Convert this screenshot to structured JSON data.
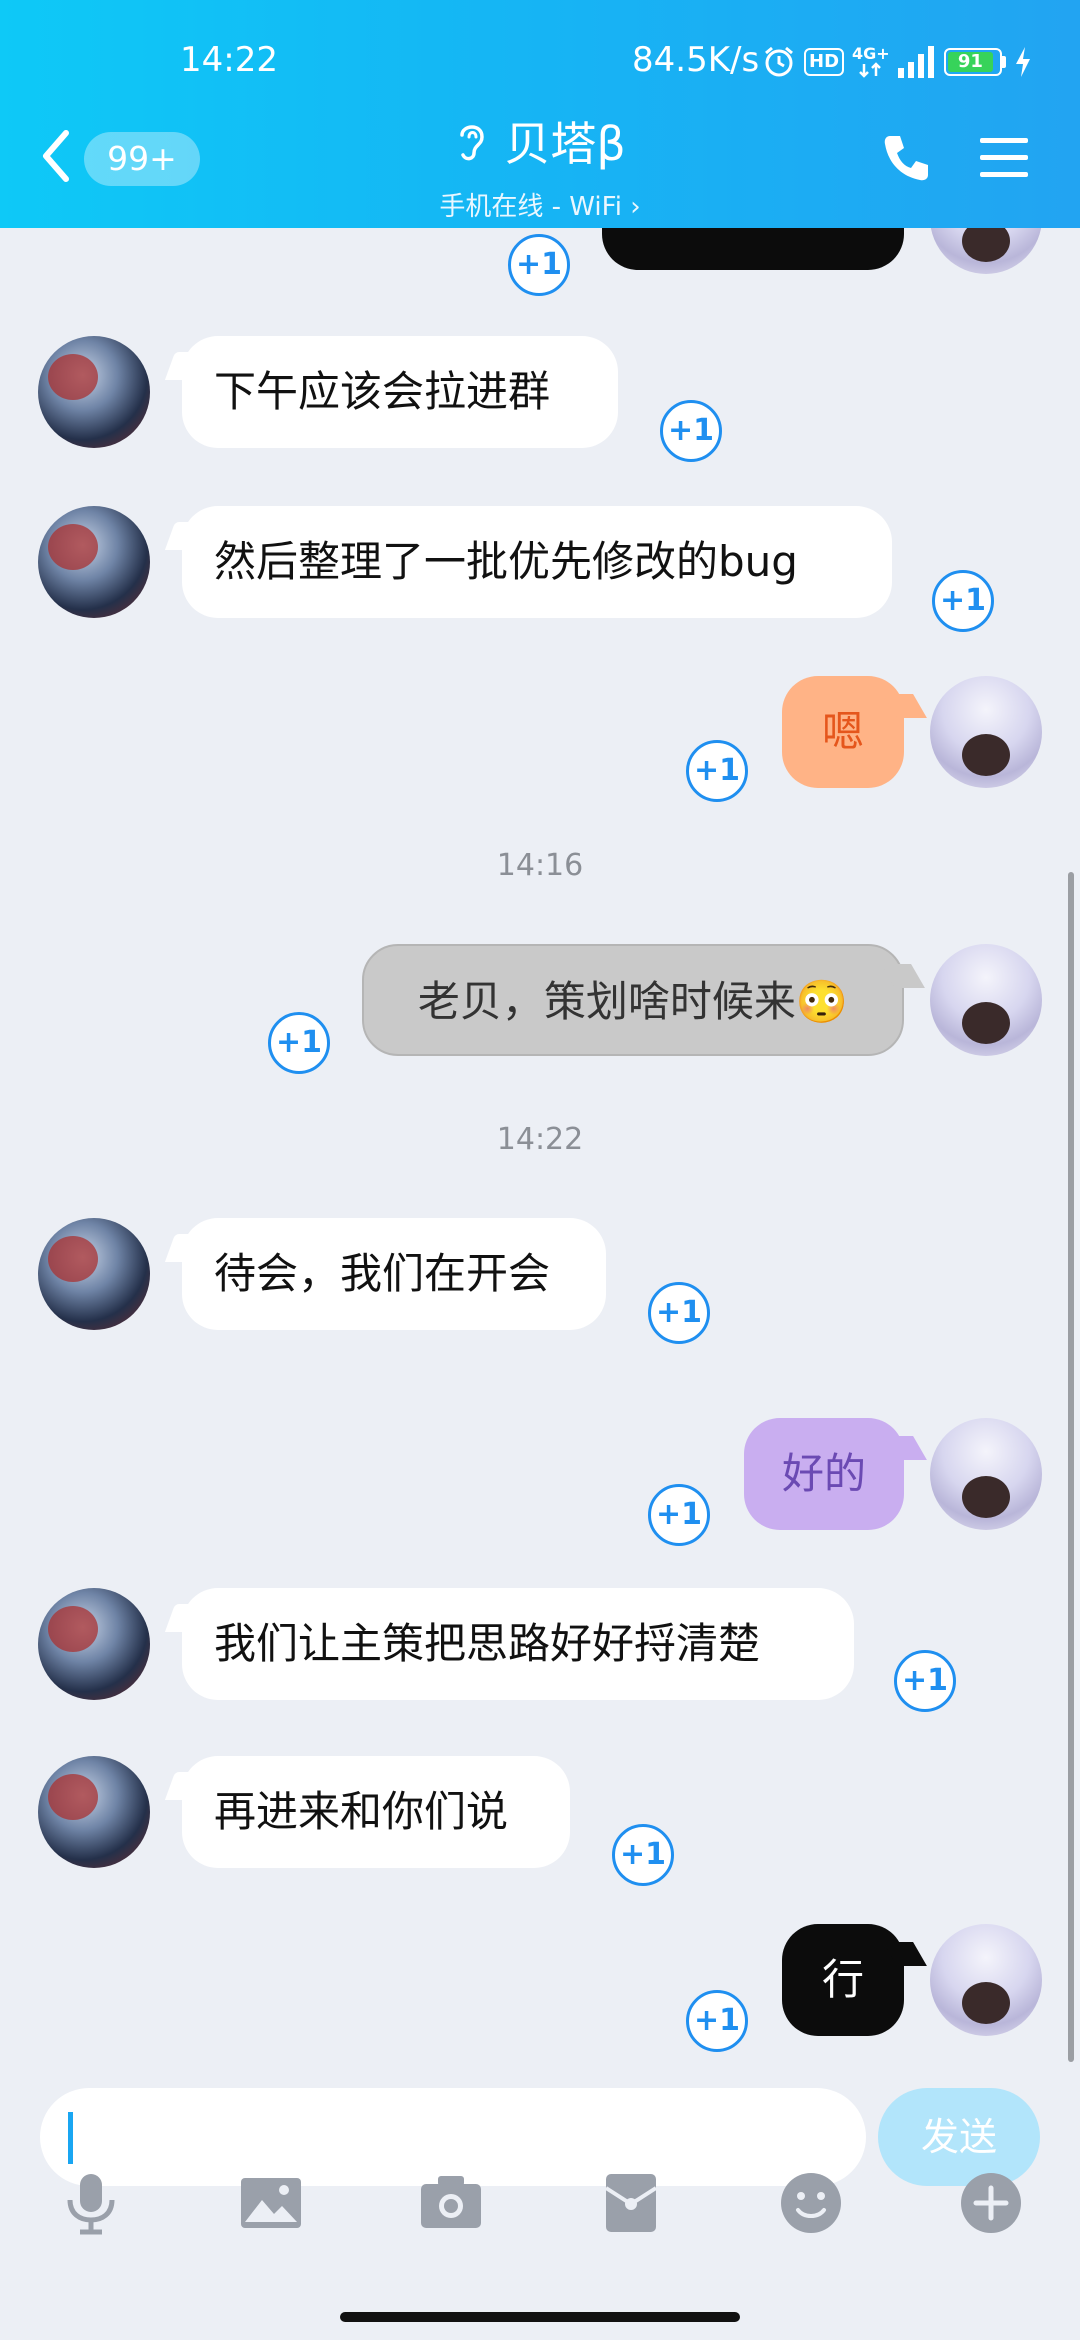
{
  "status_bar": {
    "time": "14:22",
    "net_speed": "84.5K/s",
    "hd_label": "HD",
    "network_type": "4G+",
    "battery": "91",
    "icons": [
      "alarm-icon",
      "hd-icon",
      "signal-icon",
      "battery-icon",
      "charging-icon"
    ]
  },
  "header": {
    "back_icon": "chevron-left-icon",
    "unread_badge": "99+",
    "contact_name": "贝塔β",
    "contact_status": "手机在线 - WiFi ›",
    "ear_icon": "ear-icon",
    "call_icon": "phone-icon",
    "menu_icon": "menu-icon",
    "gradient_colors": [
      "#0ec9f7",
      "#22a4f2"
    ]
  },
  "chat": {
    "plus_one_label": "+1",
    "timestamps": [
      "14:16",
      "14:22"
    ],
    "messages": [
      {
        "side": "right",
        "text": "",
        "style": "black"
      },
      {
        "side": "left",
        "text": "下午应该会拉进群"
      },
      {
        "side": "left",
        "text": "然后整理了一批优先修改的bug"
      },
      {
        "side": "right",
        "text": "嗯",
        "style": "orange"
      },
      {
        "side": "right",
        "text": "老贝，策划啥时候来😳",
        "style": "gray"
      },
      {
        "side": "left",
        "text": "待会，我们在开会"
      },
      {
        "side": "right",
        "text": "好的",
        "style": "purple"
      },
      {
        "side": "left",
        "text": "我们让主策把思路好好捋清楚"
      },
      {
        "side": "left",
        "text": "再进来和你们说"
      },
      {
        "side": "right",
        "text": "行",
        "style": "black"
      }
    ],
    "bubble_colors": {
      "orange": "#ffb386",
      "gray": "#c9c9c9",
      "purple": "#c9aef0",
      "black": "#0c0c0c"
    }
  },
  "input_bar": {
    "value": "",
    "send_label": "发送",
    "send_color": "#b2e5fb",
    "tools": [
      "microphone-icon",
      "image-icon",
      "camera-icon",
      "red-packet-icon",
      "emoji-icon",
      "plus-icon"
    ]
  }
}
